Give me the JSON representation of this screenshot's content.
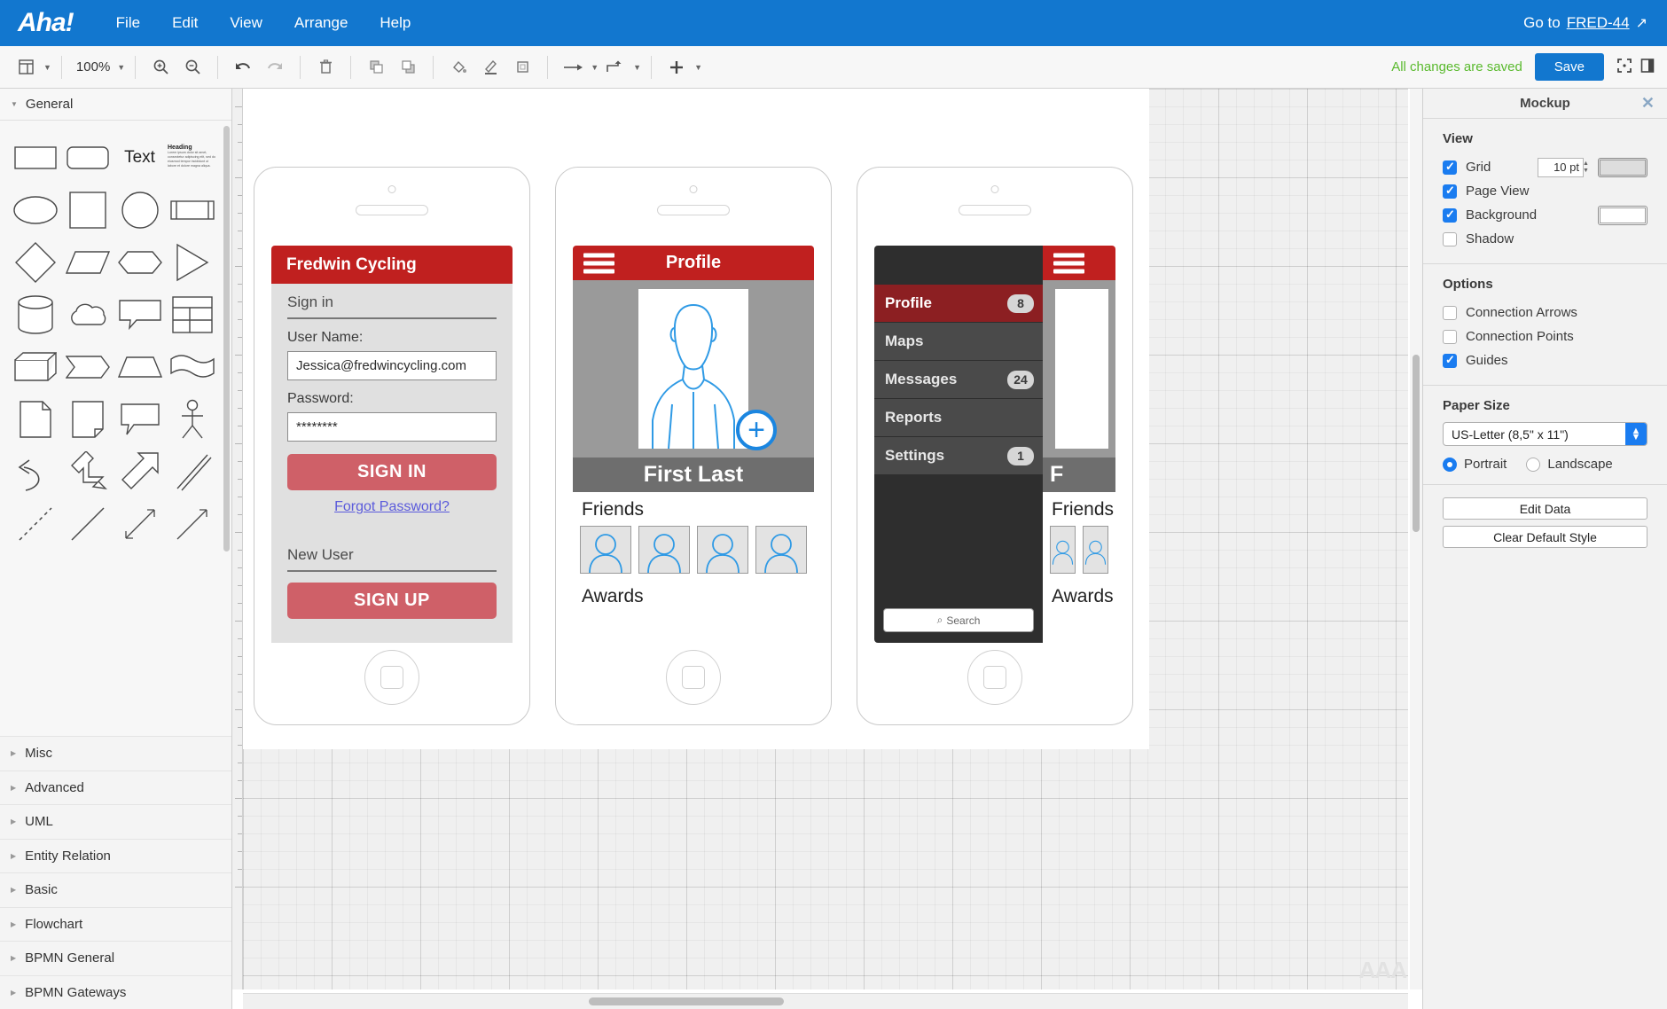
{
  "app": {
    "logo": "Aha!",
    "menus": [
      "File",
      "Edit",
      "View",
      "Arrange",
      "Help"
    ],
    "goto_prefix": "Go to",
    "goto_link": "FRED-44"
  },
  "toolbar": {
    "zoom_level": "100%",
    "saved_status": "All changes are saved",
    "save_label": "Save",
    "icons": [
      "layout-icon",
      "caret-down-icon",
      "zoom-in-icon",
      "zoom-out-icon",
      "undo-icon",
      "redo-icon",
      "delete-icon",
      "bring-front-icon",
      "send-back-icon",
      "fill-color-icon",
      "line-color-icon",
      "shadow-icon",
      "connector-icon",
      "waypoint-icon",
      "plus-icon"
    ]
  },
  "shapes_panel": {
    "general_label": "General",
    "text_shape": "Text",
    "heading_shape": "Heading",
    "heading_body": "Lorem ipsum dolor sit amet, consectetur adipiscing elit, sed do eiusmod tempor incididunt ut labore et dolore magna aliqua.",
    "categories": [
      "Misc",
      "Advanced",
      "UML",
      "Entity Relation",
      "Basic",
      "Flowchart",
      "BPMN General",
      "BPMN Gateways"
    ]
  },
  "props": {
    "title": "Mockup",
    "view": {
      "heading": "View",
      "grid_label": "Grid",
      "grid_size": "10 pt",
      "grid_checked": true,
      "page_view_label": "Page View",
      "page_view_checked": true,
      "background_label": "Background",
      "background_checked": true,
      "shadow_label": "Shadow",
      "shadow_checked": false
    },
    "options": {
      "heading": "Options",
      "connection_arrows_label": "Connection Arrows",
      "connection_arrows_checked": false,
      "connection_points_label": "Connection Points",
      "connection_points_checked": false,
      "guides_label": "Guides",
      "guides_checked": true
    },
    "paper": {
      "heading": "Paper Size",
      "selected": "US-Letter (8,5\" x 11\")",
      "portrait_label": "Portrait",
      "landscape_label": "Landscape",
      "orientation": "Portrait"
    },
    "buttons": {
      "edit_data": "Edit Data",
      "clear_default_style": "Clear Default Style"
    }
  },
  "mockups": {
    "phone1": {
      "app_title": "Fredwin Cycling",
      "signin_label": "Sign in",
      "username_label": "User Name:",
      "username_value": "Jessica@fredwincycling.com",
      "password_label": "Password:",
      "password_value": "********",
      "signin_button": "SIGN IN",
      "forgot_link": "Forgot Password?",
      "newuser_label": "New User",
      "signup_button": "SIGN UP"
    },
    "phone2": {
      "title": "Profile",
      "name": "First Last",
      "friends_label": "Friends",
      "awards_label": "Awards",
      "friend_count": 4
    },
    "phone3": {
      "menu": [
        {
          "label": "Profile",
          "badge": "8",
          "active": true
        },
        {
          "label": "Maps",
          "badge": "",
          "active": false
        },
        {
          "label": "Messages",
          "badge": "24",
          "active": false
        },
        {
          "label": "Reports",
          "badge": "",
          "active": false
        },
        {
          "label": "Settings",
          "badge": "1",
          "active": false
        }
      ],
      "search_placeholder": "Search",
      "partial_name": "F",
      "friends_label": "Friends",
      "awards_label": "Awards"
    }
  },
  "watermark": "AAA"
}
